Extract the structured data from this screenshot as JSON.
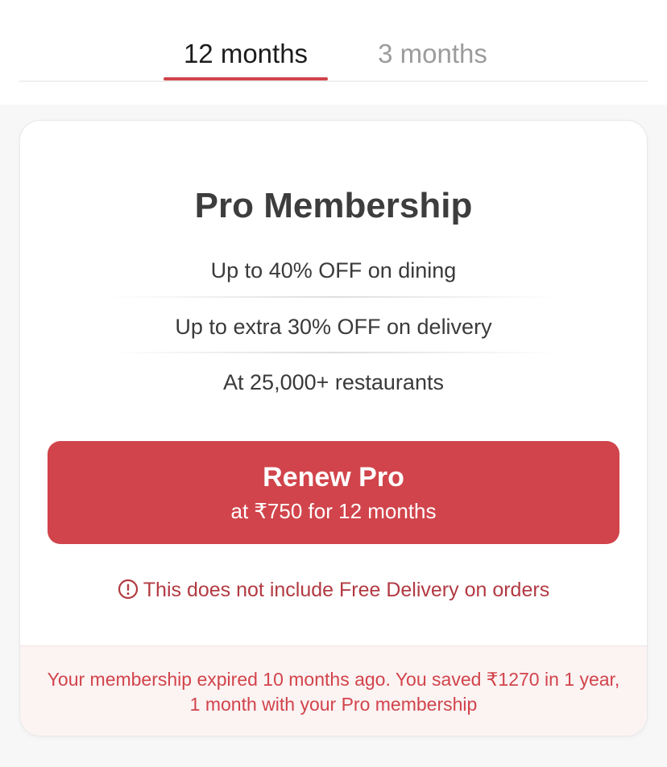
{
  "tabs": [
    {
      "label": "12 months",
      "active": true
    },
    {
      "label": "3 months",
      "active": false
    }
  ],
  "card": {
    "title": "Pro Membership",
    "benefits": [
      "Up to 40% OFF on dining",
      "Up to extra 30% OFF on delivery",
      "At 25,000+ restaurants"
    ],
    "renew_button": {
      "label": "Renew Pro",
      "sublabel": "at ₹750 for 12 months"
    },
    "warning": {
      "icon": "info-circle-icon",
      "text": "This does not include Free Delivery on orders"
    },
    "footer": {
      "text": "Your membership expired 10 months ago. You saved ₹1270 in 1 year, 1 month with your Pro membership"
    }
  },
  "colors": {
    "accent": "#d1444b",
    "warning": "#b23a42",
    "footer_bg": "#fcf3f3",
    "title": "#3d3d3d",
    "inactive_tab": "#9c9c9c"
  }
}
